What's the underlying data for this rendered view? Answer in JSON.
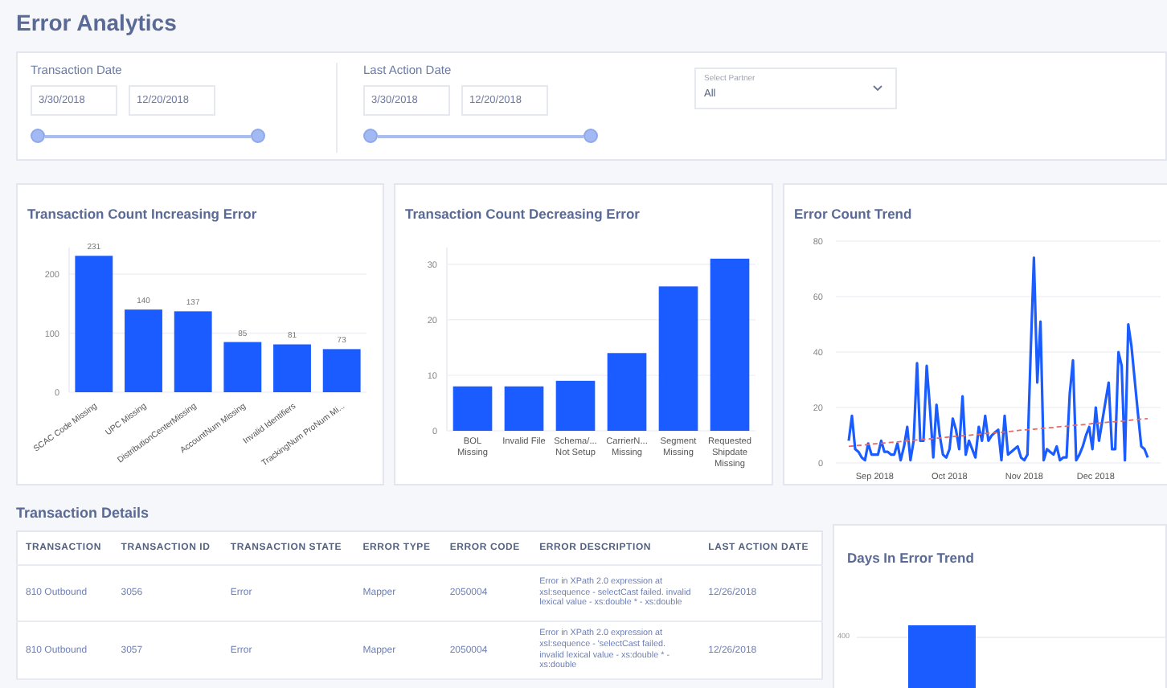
{
  "title": "Error Analytics",
  "filters": {
    "date_ranges": [
      {
        "label": "Transaction Date",
        "dates": [
          "3/30/2018",
          "12/20/2018"
        ]
      },
      {
        "label": "Last Action Date",
        "dates": [
          "3/30/2018",
          "12/20/2018"
        ]
      }
    ],
    "partner_select": {
      "label": "Select Partner",
      "value": "All"
    }
  },
  "charts": [
    {
      "chart_data": {
        "type": "bar",
        "title": "Transaction Count Increasing Error",
        "categories": [
          "SCAC Code Missing",
          "UPC Missing",
          "DistributionCenterMissing",
          "AccountNum Missing",
          "Invalid Identifiers",
          "TrackingNum ProNum Mi..."
        ],
        "values": [
          231,
          140,
          137,
          85,
          81,
          73
        ],
        "ylim": [
          0,
          245
        ],
        "yticks": [
          0,
          100,
          200
        ],
        "grid": true,
        "data_labels": true,
        "color": "#1a5cff"
      }
    },
    {
      "chart_data": {
        "type": "bar",
        "title": "Transaction Count Decreasing Error",
        "categories": [
          "BOL Missing",
          "Invalid File",
          "Schema/... Not Setup",
          "CarrierN... Missing",
          "Segment Missing",
          "Requested Shipdate Missing"
        ],
        "values": [
          8,
          8,
          9,
          14,
          26,
          31
        ],
        "ylim": [
          0,
          33
        ],
        "yticks": [
          0,
          10,
          20,
          30
        ],
        "grid": true,
        "color": "#1a5cff"
      }
    },
    {
      "chart_data": {
        "type": "line",
        "title": "Error Count Trend",
        "categories": [
          null,
          null,
          null,
          null,
          null,
          null,
          null,
          null,
          "Sep 2018",
          null,
          null,
          null,
          null,
          null,
          null,
          null,
          null,
          null,
          null,
          null,
          null,
          null,
          null,
          null,
          null,
          null,
          null,
          null,
          null,
          null,
          null,
          "Oct 2018",
          null,
          null,
          null,
          null,
          null,
          null,
          null,
          null,
          null,
          null,
          null,
          null,
          null,
          null,
          null,
          null,
          null,
          null,
          null,
          null,
          null,
          null,
          "Nov 2018",
          null,
          null,
          null,
          null,
          null,
          null,
          null,
          null,
          null,
          null,
          null,
          null,
          null,
          null,
          null,
          null,
          null,
          null,
          null,
          null,
          null,
          "Dec 2018",
          null,
          null,
          null,
          null,
          null,
          null,
          null,
          null,
          null,
          null,
          null,
          null,
          null,
          null,
          null,
          null
        ],
        "grid": true,
        "series": [
          {
            "color": "#1a5cff",
            "line_style": "solid",
            "values": [
              8,
              17,
              5,
              4,
              2,
              1,
              7,
              3,
              3,
              3,
              8,
              4,
              4,
              3,
              3,
              7,
              1,
              6,
              13,
              1,
              8,
              36,
              8,
              8,
              35,
              20,
              2,
              21,
              10,
              3,
              2,
              5,
              16,
              12,
              5,
              24,
              3,
              8,
              5,
              2,
              13,
              8,
              17,
              8,
              10,
              11,
              12,
              1,
              17,
              3,
              4,
              5,
              6,
              2,
              1,
              3,
              40,
              74,
              29,
              51,
              1,
              5,
              4,
              3,
              6,
              1,
              2,
              2,
              25,
              37,
              1,
              3,
              6,
              10,
              13,
              5,
              20,
              8,
              15,
              22,
              29,
              5,
              5,
              40,
              35,
              1,
              50,
              42,
              30,
              18,
              6,
              5,
              2
            ]
          },
          {
            "color": "#e86a6a",
            "line_style": "dashed",
            "values": [
              6.0,
              6.1,
              6.2,
              6.3,
              6.4,
              6.5,
              6.7,
              6.8,
              6.9,
              7.0,
              7.1,
              7.2,
              7.3,
              7.4,
              7.5,
              7.6,
              7.7,
              7.8,
              8.0,
              8.1,
              8.2,
              8.3,
              8.4,
              8.5,
              8.6,
              8.7,
              8.8,
              8.9,
              9.0,
              9.2,
              9.3,
              9.4,
              9.5,
              9.6,
              9.7,
              9.8,
              9.9,
              10.0,
              10.1,
              10.2,
              10.3,
              10.5,
              10.6,
              10.7,
              10.8,
              10.9,
              11.0,
              11.1,
              11.2,
              11.3,
              11.4,
              11.5,
              11.7,
              11.8,
              11.9,
              12.0,
              12.1,
              12.2,
              12.3,
              12.4,
              12.5,
              12.6,
              12.7,
              12.8,
              13.0,
              13.1,
              13.2,
              13.3,
              13.4,
              13.5,
              13.6,
              13.7,
              13.8,
              13.9,
              14.0,
              14.2,
              14.3,
              14.4,
              14.5,
              14.6,
              14.7,
              14.8,
              14.9,
              15.0,
              15.1,
              15.2,
              15.3,
              15.5,
              15.6,
              15.7,
              15.8,
              15.9,
              16.0
            ]
          }
        ],
        "ylim": [
          0,
          80
        ],
        "yticks": [
          0,
          20,
          40,
          60,
          80
        ]
      }
    }
  ],
  "details": {
    "title": "Transaction Details",
    "columns": [
      "TRANSACTION",
      "TRANSACTION ID",
      "TRANSACTION STATE",
      "ERROR TYPE",
      "ERROR CODE",
      "ERROR DESCRIPTION",
      "LAST ACTION DATE"
    ],
    "rows": [
      [
        "810 Outbound",
        "3056",
        "Error",
        "Mapper",
        "2050004",
        "Error in XPath 2.0 expression at xsl:sequence - selectCast failed. invalid lexical value - xs:double * - xs:double",
        "12/26/2018"
      ],
      [
        "810 Outbound",
        "3057",
        "Error",
        "Mapper",
        "2050004",
        "Error in XPath 2.0 expression at xsl:sequence - 'selectCast failed. invalid lexical value - xs:double * - xs:double",
        "12/26/2018"
      ]
    ]
  },
  "days_in_error": {
    "title": "Days In Error Trend",
    "tick": "400"
  }
}
